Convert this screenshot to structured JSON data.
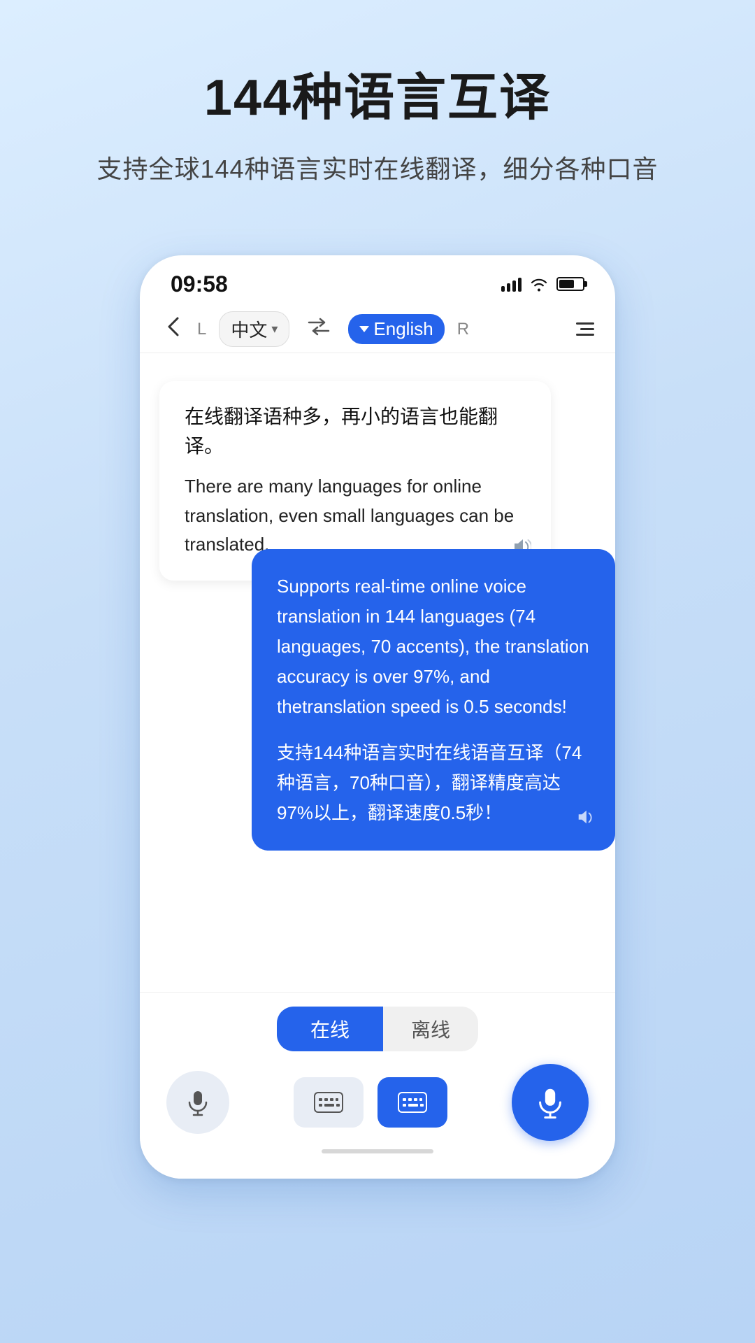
{
  "header": {
    "title": "144种语言互译",
    "subtitle": "支持全球144种语言实时在线翻译，细分各种口音"
  },
  "phone": {
    "status_bar": {
      "time": "09:58"
    },
    "nav": {
      "lang_left_label": "中文",
      "lang_right_label": "English",
      "lang_left_prefix": "L",
      "lang_right_suffix": "R"
    },
    "bubble_left": {
      "cn_text": "在线翻译语种多，再小的语言也能翻译。",
      "en_text": "There are many languages for online translation, even small languages can be translated."
    },
    "bubble_right": {
      "en_text": "Supports real-time online voice translation in 144 languages (74 languages, 70 accents), the translation accuracy is over 97%, and thetranslation speed is 0.5 seconds!",
      "cn_text": "支持144种语言实时在线语音互译（74种语言，70种口音），翻译精度高达97%以上，翻译速度0.5秒！"
    },
    "bottom": {
      "mode_online": "在线",
      "mode_offline": "离线"
    }
  }
}
